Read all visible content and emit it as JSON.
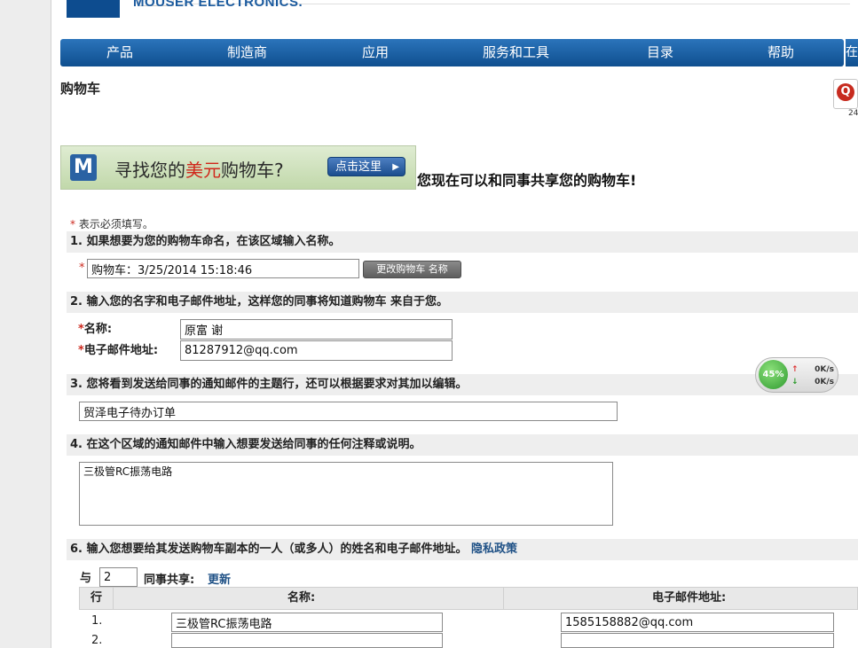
{
  "header": {
    "logo_text": "MOUSER ELECTRONICS."
  },
  "nav": {
    "items": [
      "产品",
      "制造商",
      "应用",
      "服务和工具",
      "目录",
      "帮助"
    ],
    "extra": "在"
  },
  "page": {
    "title": "购物车",
    "badge_letter": "Q",
    "badge_number": "24"
  },
  "banner": {
    "logo_letter": "M",
    "text_before": "寻找您的",
    "text_highlight": "美元",
    "text_after": "购物车?",
    "button_label": "点击这里",
    "button_arrow": "▶",
    "share_message": "您现在可以和同事共享您的购物车!"
  },
  "form": {
    "required_star": "*",
    "required_note": "表示必须填写。",
    "section1": "1. 如果想要为您的购物车命名，在该区域输入名称。",
    "cart_name_value": "购物车：3/25/2014 15:18:46",
    "rename_button": "更改购物车 名称",
    "section2": "2. 输入您的名字和电子邮件地址，这样您的同事将知道购物车 来自于您。",
    "name_label": "名称:",
    "name_value": "原富 谢",
    "email_label": "电子邮件地址:",
    "email_value": "81287912@qq.com",
    "section3": "3. 您将看到发送给同事的通知邮件的主题行，还可以根据要求对其加以编辑。",
    "subject_value": "贸泽电子待办订单",
    "section4": "4. 在这个区域的通知邮件中输入想要发送给同事的任何注释或说明。",
    "notes_value": "三极管RC振荡电路",
    "section6": "6. 输入您想要给其发送购物车副本的一人（或多人）的姓名和电子邮件地址。",
    "privacy_link": "隐私政策",
    "share_with": "与",
    "share_count": "2",
    "colleagues_share": "同事共享:",
    "update_link": "更新"
  },
  "table": {
    "headers": [
      "行",
      "名称:",
      "电子邮件地址:"
    ],
    "rows": [
      {
        "num": "1.",
        "name": "三极管RC振荡电路",
        "email": "1585158882@qq.com"
      },
      {
        "num": "2.",
        "name": "",
        "email": ""
      }
    ]
  },
  "speed_widget": {
    "percent": "45%",
    "up_arrow": "↑",
    "down_arrow": "↓",
    "up_speed": "0K/s",
    "down_speed": "0K/s",
    "load_fraction": 0.45
  }
}
